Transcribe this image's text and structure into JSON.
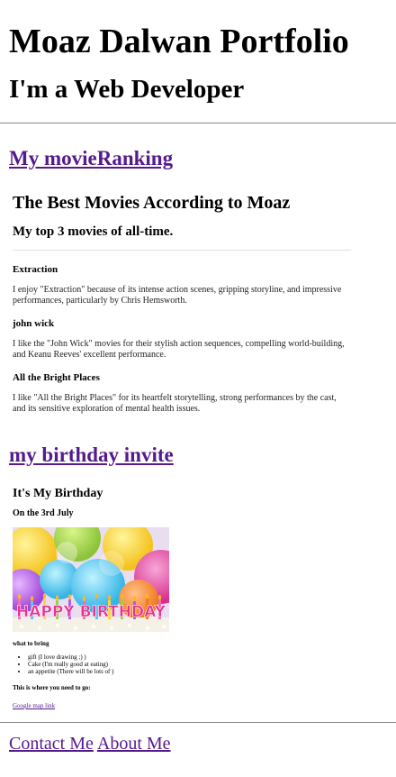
{
  "header": {
    "title": "Moaz Dalwan Portfolio",
    "subtitle": "I'm a Web Developer"
  },
  "projects": [
    {
      "link_label": "My movieRanking"
    },
    {
      "link_label": "my birthday invite"
    }
  ],
  "movie_ranking": {
    "title": "The Best Movies According to Moaz",
    "subtitle": "My top 3 movies of all-time.",
    "movies": [
      {
        "name": "Extraction",
        "description_line1": "I enjoy \"Extraction\" because of its intense action scenes, gripping storyline, and impressive",
        "description_line2": "performances, particularly by Chris Hemsworth."
      },
      {
        "name": "john wick",
        "description_line1": "I like the \"John Wick\" movies for their stylish action sequences, compelling world-building,",
        "description_line2": "and Keanu Reeves' excellent performance."
      },
      {
        "name": "All the Bright Places",
        "description_line1": "I like \"All the Bright Places\" for its heartfelt storytelling, strong performances by the cast,",
        "description_line2": "and its sensitive exploration of mental health issues."
      }
    ]
  },
  "birthday_invite": {
    "title": "It's My Birthday",
    "date": "On the 3rd July",
    "image_text": "HAPPY BIRTHDAY",
    "bring_heading": "what to bring",
    "bring_items": [
      "gift (I love drawing ;) )",
      "Cake (I'm really good at eating)",
      "an appetite (There will be lots of )"
    ],
    "location_heading": "This is where you need to go:",
    "map_link": "Google map link"
  },
  "footer": {
    "contact": "Contact Me",
    "about": "About Me"
  },
  "colors": {
    "link": "#551a8b",
    "divider": "#888888"
  }
}
